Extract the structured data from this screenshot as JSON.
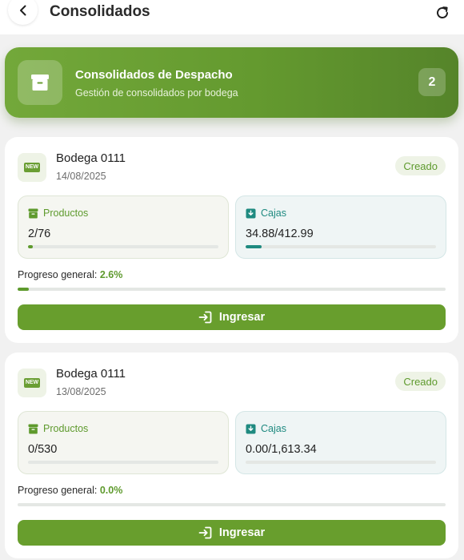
{
  "header": {
    "title": "Consolidados",
    "back_icon": "chevron-left-icon",
    "refresh_icon": "refresh-icon"
  },
  "hero": {
    "title": "Consolidados de Despacho",
    "subtitle": "Gestión de consolidados por bodega",
    "count": "2",
    "icon": "archive-box-icon"
  },
  "colors": {
    "brand_green": "#689e2d",
    "accent_teal": "#1f8a80"
  },
  "cards": [
    {
      "icon_text": "NEW",
      "name": "Bodega 0111",
      "date": "14/08/2025",
      "status": "Creado",
      "productos_label": "Productos",
      "productos_value": "2/76",
      "productos_progress": 0.026,
      "cajas_label": "Cajas",
      "cajas_value": "34.88/412.99",
      "cajas_progress": 0.084,
      "overall_label": "Progreso general:",
      "overall_value": "2.6%",
      "overall_progress": 0.026,
      "button_label": "Ingresar"
    },
    {
      "icon_text": "NEW",
      "name": "Bodega 0111",
      "date": "13/08/2025",
      "status": "Creado",
      "productos_label": "Productos",
      "productos_value": "0/530",
      "productos_progress": 0,
      "cajas_label": "Cajas",
      "cajas_value": "0.00/1,613.34",
      "cajas_progress": 0,
      "overall_label": "Progreso general:",
      "overall_value": "0.0%",
      "overall_progress": 0,
      "button_label": "Ingresar"
    }
  ]
}
